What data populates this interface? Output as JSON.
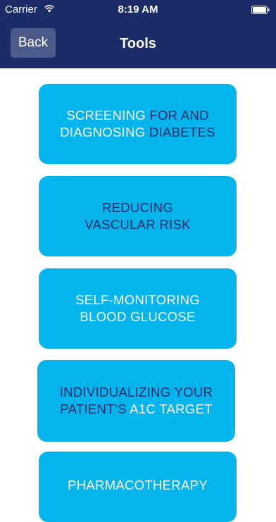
{
  "status_bar": {
    "carrier": "Carrier",
    "time": "8:19 AM",
    "wifi_icon": "wifi-icon",
    "battery_icon": "battery-icon"
  },
  "nav": {
    "back_label": "Back",
    "title": "Tools"
  },
  "colors": {
    "nav_background": "#1c2c68",
    "button_background": "#04b4ec",
    "button_text_dark": "#1c2c68",
    "button_text_light": "#ffffff"
  },
  "tools": [
    {
      "line1": {
        "a": "SCREENING",
        "b": " FOR AND"
      },
      "line2": {
        "a": "DIAGNOSING",
        "b": " DIABETES"
      }
    },
    {
      "line1": {
        "a": "REDUCING"
      },
      "line2": {
        "a": "VASCULAR RISK"
      }
    },
    {
      "line1": {
        "a": "SELF-MONITORING"
      },
      "line2": {
        "a": "BLOOD GLUCOSE"
      }
    },
    {
      "line1": {
        "a": "INDIVIDUALIZING YOUR"
      },
      "line2": {
        "a": "PATIENT’S",
        "b": " A1C TARGET"
      }
    },
    {
      "line1": {
        "a": "PHARMACOTHERAPY"
      }
    }
  ]
}
